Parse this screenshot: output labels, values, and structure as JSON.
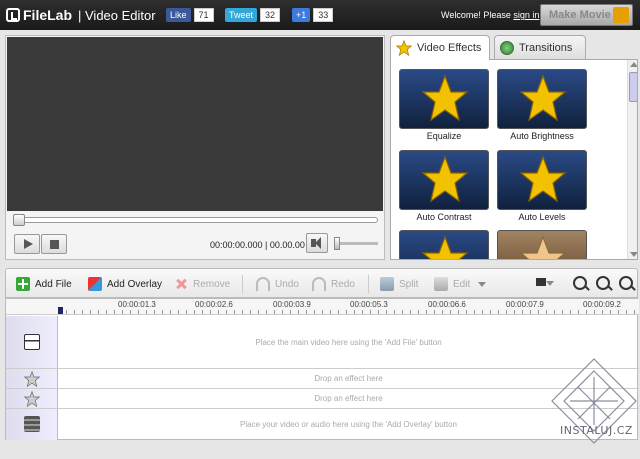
{
  "header": {
    "logo": "FileLab",
    "app_title": "| Video Editor",
    "facebook_like": "Like",
    "facebook_count": "71",
    "tweet": "Tweet",
    "tweet_count": "32",
    "gplus": "+1",
    "gplus_count": "33",
    "welcome_text": "Welcome! Please ",
    "sign_in": "sign in",
    "make_movie": "Make Movie"
  },
  "preview": {
    "timecode": "00:00:00.000 | 00.00.00"
  },
  "effects_panel": {
    "tabs": [
      "Video Effects",
      "Transitions"
    ],
    "effects": [
      "Equalize",
      "Auto Brightness",
      "Auto Contrast",
      "Auto Levels"
    ]
  },
  "toolbar": {
    "add_file": "Add File",
    "add_overlay": "Add Overlay",
    "remove": "Remove",
    "undo": "Undo",
    "redo": "Redo",
    "split": "Split",
    "edit": "Edit"
  },
  "timeline": {
    "ruler_labels": [
      "00:00:01.3",
      "00:00:02.6",
      "00:00:03.9",
      "00:00:05.3",
      "00:00:06.6",
      "00:00:07.9",
      "00:00:09.2"
    ],
    "main_track_hint": "Place the main video here using the 'Add File' button",
    "effect_track_hint_1": "Drop an effect here",
    "effect_track_hint_2": "Drop an effect here",
    "overlay_track_hint": "Place your video or audio here using the 'Add Overlay' button"
  },
  "watermark": {
    "text": "INSTALUJ.CZ"
  },
  "colors": {
    "header_bg": "#1a1a1a",
    "effect_tile_bg": "#1c3566",
    "star": "#f2c200",
    "add_icon": "#33aa33"
  }
}
